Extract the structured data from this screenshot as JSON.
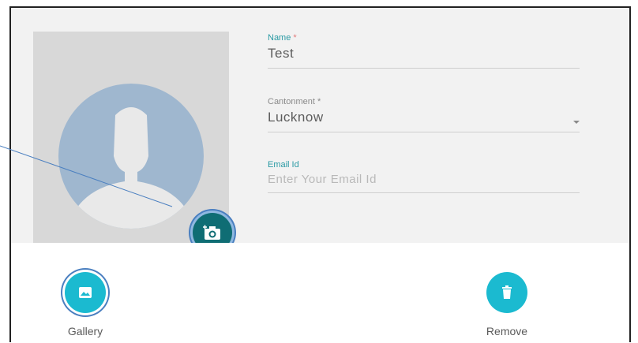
{
  "form": {
    "name": {
      "label": "Name",
      "required_mark": "*",
      "value": "Test"
    },
    "cantonment": {
      "label": "Cantonment",
      "required_mark": "*",
      "value": "Lucknow"
    },
    "email": {
      "label": "Email Id",
      "placeholder": "Enter Your Email Id"
    }
  },
  "photo": {
    "avatar_icon": "person-silhouette-icon",
    "camera_button_icon": "camera-add-icon"
  },
  "sheet": {
    "gallery": {
      "label": "Gallery",
      "icon": "image-icon"
    },
    "remove": {
      "label": "Remove",
      "icon": "trash-icon"
    }
  },
  "colors": {
    "accent": "#2a9aa4",
    "action": "#1bbad0",
    "camera_button": "#0f6d74",
    "highlight_ring": "#4a7fc0"
  }
}
